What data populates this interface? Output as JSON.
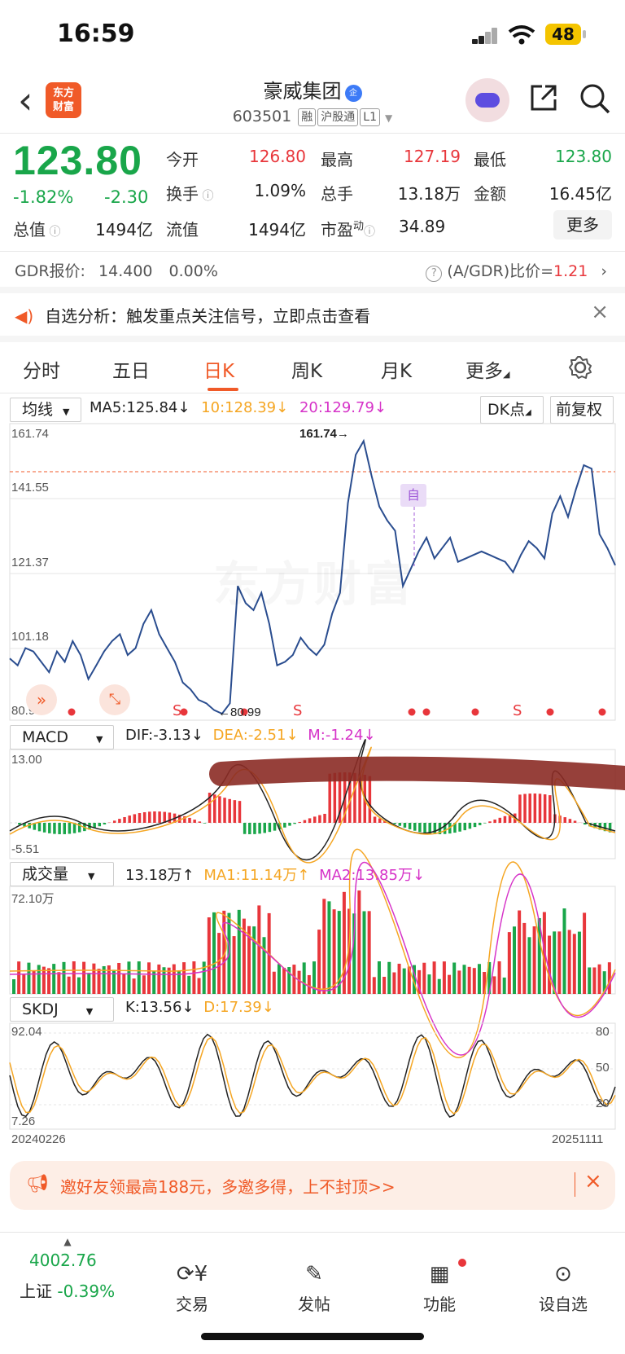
{
  "status_bar": {
    "time": "16:59",
    "battery": "48"
  },
  "header": {
    "back_icon": "chevron-left-icon",
    "logo_text": "东方财富",
    "title": "豪威集团",
    "title_badge": "企",
    "code": "603501",
    "tags": [
      "融",
      "沪股通",
      "L1"
    ]
  },
  "quote": {
    "price": "123.80",
    "change_pct": "-1.82%",
    "change": "-2.30",
    "fields": [
      {
        "label": "今开",
        "value": "126.80",
        "color": "red"
      },
      {
        "label": "最高",
        "value": "127.19",
        "color": "red"
      },
      {
        "label": "最低",
        "value": "123.80",
        "color": "green"
      },
      {
        "label": "换手",
        "value": "1.09%",
        "color": "black"
      },
      {
        "label": "总手",
        "value": "13.18万",
        "color": "black"
      },
      {
        "label": "金额",
        "value": "16.45亿",
        "color": "black"
      },
      {
        "label": "总值",
        "value": "1494亿",
        "color": "black"
      },
      {
        "label": "流值",
        "value": "1494亿",
        "color": "black"
      },
      {
        "label": "市盈",
        "label_sup": "动",
        "value": "34.89",
        "color": "black"
      }
    ],
    "more_button": "更多"
  },
  "gdr": {
    "label": "GDR报价:",
    "price": "14.400",
    "pct": "0.00%",
    "ratio_label": "(A/GDR)比价=",
    "ratio_value": "1.21"
  },
  "notice": {
    "text": "自选分析：触发重点关注信号，立即点击查看"
  },
  "tabs": [
    "分时",
    "五日",
    "日K",
    "周K",
    "月K",
    "更多"
  ],
  "active_tab": "日K",
  "main_chart": {
    "selector": "均线",
    "ma5": "MA5:125.84",
    "ma10": "10:128.39",
    "ma20": "20:129.79",
    "dk_button": "DK点",
    "fq_button": "前复权",
    "y_labels": [
      "161.74",
      "141.55",
      "121.37",
      "101.18",
      "80.99"
    ],
    "high_mark": "161.74",
    "low_mark": "80.99",
    "self_tag": "自",
    "watermark": "东方财富",
    "signal_s": "S"
  },
  "macd": {
    "selector": "MACD",
    "dif": "DIF:-3.13",
    "dea": "DEA:-2.51",
    "m": "M:-1.24",
    "y_top": "13.00",
    "y_bottom": "-5.51"
  },
  "volume": {
    "selector": "成交量",
    "vol": "13.18万",
    "ma1": "MA1:11.14万",
    "ma2": "MA2:13.85万",
    "y_top": "72.10万"
  },
  "skdj": {
    "selector": "SKDJ",
    "k": "K:13.56",
    "d": "D:17.39",
    "y_top": "92.04",
    "y_bottom": "7.26",
    "right_labels": [
      "80",
      "50",
      "20"
    ],
    "date_start": "20240226",
    "date_end": "20251111"
  },
  "chart_data": {
    "type": "line",
    "title": "",
    "xlabel": "",
    "ylabel": "",
    "x_start": "20240226",
    "x_end": "20251111",
    "ylim": [
      80.99,
      161.74
    ],
    "series": [
      {
        "values": [
          97,
          95,
          100,
          99,
          96,
          93,
          99,
          96,
          102,
          98,
          91,
          95,
          99,
          102,
          104,
          98,
          100,
          107,
          111,
          104,
          100,
          96,
          90,
          88,
          85,
          84,
          82,
          81,
          84,
          118,
          113,
          111,
          116,
          107,
          95,
          96,
          98,
          103,
          100,
          98,
          101,
          110,
          116,
          142,
          156,
          160,
          150,
          141,
          137,
          134,
          118,
          123,
          128,
          132,
          126,
          129,
          132,
          125,
          126,
          127,
          128,
          127,
          126,
          125,
          122,
          127,
          131,
          129,
          126,
          139,
          144,
          138,
          146,
          153,
          152,
          133,
          129,
          124
        ]
      }
    ]
  },
  "ad_banner": {
    "text": "邀好友领最高188元，多邀多得，上不封顶>>"
  },
  "bottom_nav": {
    "index_value": "4002.76",
    "index_name": "上证",
    "index_pct": "-0.39%",
    "items": [
      "交易",
      "发帖",
      "功能",
      "设自选"
    ]
  }
}
